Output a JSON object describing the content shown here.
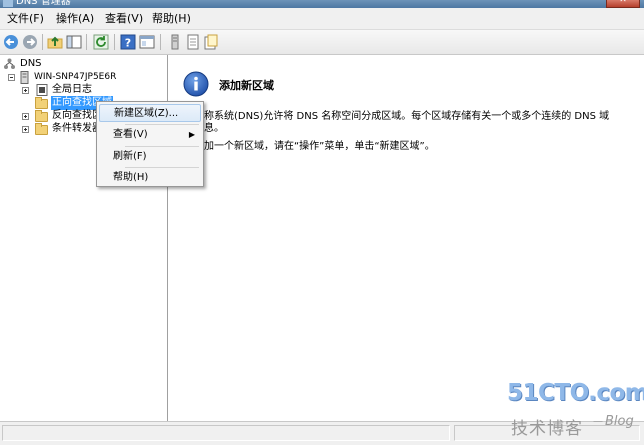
{
  "window": {
    "title": "DNS 管理器"
  },
  "menubar": {
    "items": [
      {
        "label": "文件(F)"
      },
      {
        "label": "操作(A)"
      },
      {
        "label": "查看(V)"
      },
      {
        "label": "帮助(H)"
      }
    ]
  },
  "toolbar": {
    "buttons": [
      "back-arrow-icon",
      "forward-arrow-icon",
      "up-folder-icon",
      "show-hide-tree-icon",
      "refresh-icon",
      "help-icon",
      "properties-icon",
      "server-icon",
      "list-icon",
      "document-icon"
    ]
  },
  "tree": {
    "root": "DNS",
    "server": "WIN-SNP47JP5E6R",
    "global_logs": "全局日志",
    "forward_zone": "正向查找区域",
    "reverse_zone": "反向查找区域",
    "conditional_forwarders": "条件转发器"
  },
  "context_menu": {
    "new_zone": "新建区域(Z)...",
    "view": "查看(V)",
    "refresh": "刷新(F)",
    "help": "帮助(H)"
  },
  "content": {
    "heading": "添加新区域",
    "para1_line1": "称系统(DNS)允许将 DNS 名称空间分成区域。每个区域存储有关一个或多个连续的 DNS 域",
    "para1_line2": "息。",
    "para2": "加一个新区域，请在“操作”菜单，单击“新建区域”。"
  },
  "watermark": {
    "site": "51CTO.com",
    "sub": "技术博客",
    "blog": "Blog"
  },
  "colors": {
    "accent": "#3f6da8",
    "selection": "#3399ff",
    "info_icon": "#1f4fa8"
  }
}
